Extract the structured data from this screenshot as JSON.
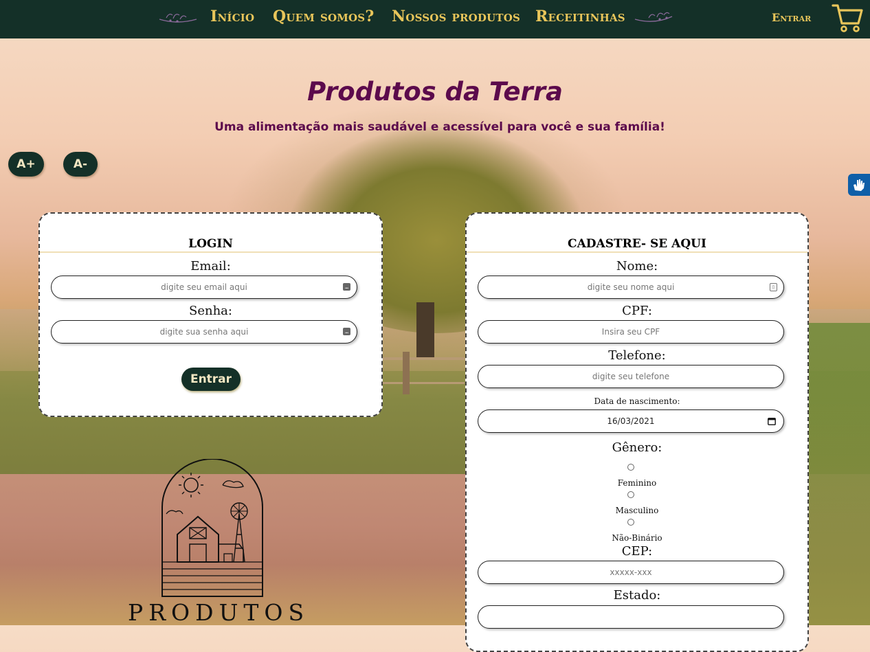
{
  "nav": {
    "links": [
      "Início",
      "Quem somos?",
      "Nossos produtos",
      "Receitinhas"
    ],
    "login_label": "Entrar",
    "cart_icon": "cart-icon",
    "accent_color": "#e8c55a",
    "bg_color": "#143028"
  },
  "hero": {
    "title": "Produtos da Terra",
    "subtitle": "Uma alimentação mais saudável e acessível para você e sua família!",
    "title_color": "#5c0a4c"
  },
  "font_controls": {
    "increase": "A+",
    "decrease": "A-"
  },
  "accessibility": {
    "icon": "vlibras-hand-icon"
  },
  "login": {
    "title": "LOGIN",
    "email_label": "Email:",
    "email_placeholder": "digite seu email aqui",
    "password_label": "Senha:",
    "password_placeholder": "digite sua senha aqui",
    "submit_label": "Entrar"
  },
  "signup": {
    "title": "CADASTRE- SE AQUI",
    "name_label": "Nome:",
    "name_placeholder": "digite seu nome aqui",
    "cpf_label": "CPF:",
    "cpf_placeholder": "Insira seu CPF",
    "phone_label": "Telefone:",
    "phone_placeholder": "digite seu telefone",
    "birth_label": "Data de nascimento:",
    "birth_value": "16/03/2021",
    "gender_label": "Gênero:",
    "gender_options": [
      "Feminino",
      "Masculino",
      "Não-Binário"
    ],
    "cep_label": "CEP:",
    "cep_placeholder": "xxxxx-xxx",
    "state_label": "Estado:",
    "state_value": ""
  },
  "logo": {
    "text": "PRODUTOS"
  }
}
